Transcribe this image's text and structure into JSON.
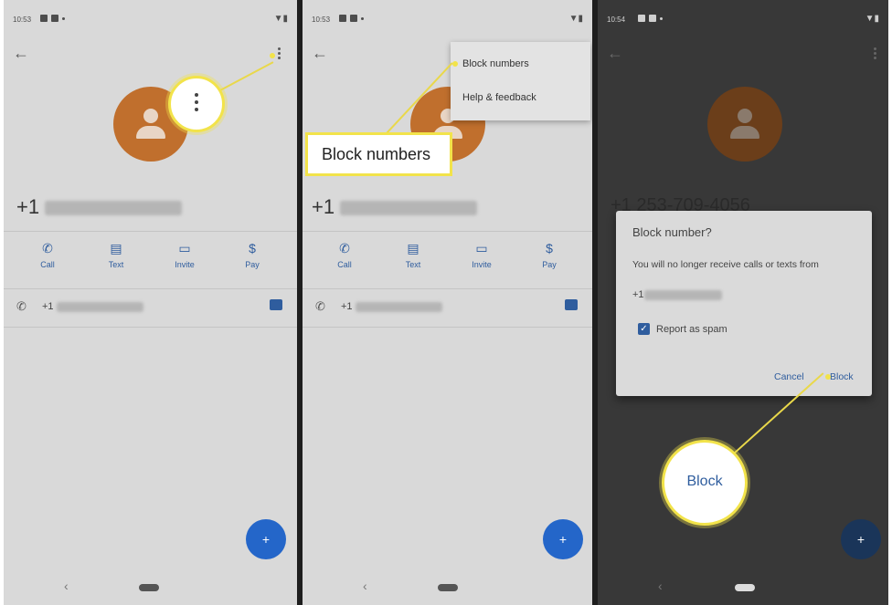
{
  "status": {
    "panel1_time": "10:53",
    "panel2_time": "10:53",
    "panel3_time": "10:54"
  },
  "contact": {
    "phone_prefix": "+1",
    "phone_number_visible_panel3": "+1 253-709-4056"
  },
  "actions": [
    {
      "label": "Call",
      "icon": "phone-icon"
    },
    {
      "label": "Text",
      "icon": "message-icon"
    },
    {
      "label": "Invite",
      "icon": "video-icon"
    },
    {
      "label": "Pay",
      "icon": "dollar-icon"
    }
  ],
  "history_row": {
    "prefix": "+1"
  },
  "callouts": {
    "menu_label": "Block numbers",
    "block_label": "Block"
  },
  "menu": {
    "items": [
      "Block numbers",
      "Help & feedback"
    ]
  },
  "dialog": {
    "title": "Block number?",
    "body": "You will no longer receive calls or texts from",
    "number_prefix": "+1",
    "checkbox_label": "Report as spam",
    "checkbox_checked": true,
    "cancel": "Cancel",
    "block": "Block"
  },
  "colors": {
    "accent_blue": "#2466c9",
    "avatar_orange": "#c06f2d",
    "highlight_yellow": "#f2e34a"
  }
}
